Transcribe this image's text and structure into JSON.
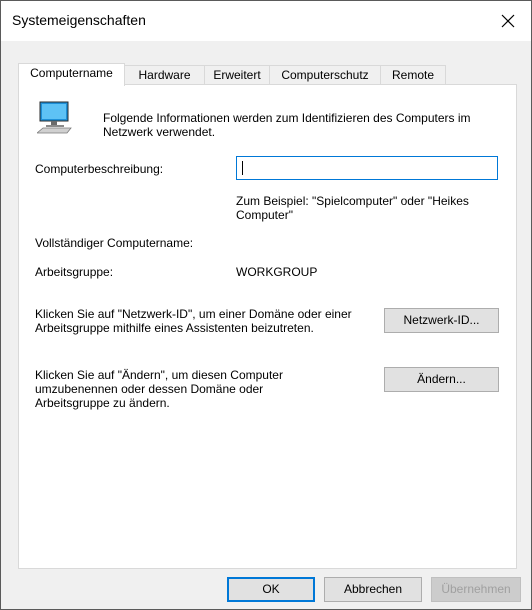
{
  "window": {
    "title": "Systemeigenschaften"
  },
  "tabs": [
    {
      "label": "Computername",
      "active": true
    },
    {
      "label": "Hardware",
      "active": false
    },
    {
      "label": "Erweitert",
      "active": false
    },
    {
      "label": "Computerschutz",
      "active": false
    },
    {
      "label": "Remote",
      "active": false
    }
  ],
  "info": {
    "text": "Folgende Informationen werden zum Identifizieren des Computers im Netzwerk verwendet."
  },
  "description": {
    "label": "Computerbeschreibung:",
    "value": "",
    "hint": "Zum Beispiel: \"Spielcomputer\" oder \"Heikes Computer\""
  },
  "full_name": {
    "label": "Vollständiger Computername:",
    "value": ""
  },
  "workgroup": {
    "label": "Arbeitsgruppe:",
    "value": "WORKGROUP"
  },
  "network_id": {
    "text": "Klicken Sie auf \"Netzwerk-ID\", um einer Domäne oder einer Arbeitsgruppe mithilfe eines Assistenten beizutreten.",
    "button": "Netzwerk-ID..."
  },
  "change": {
    "text": "Klicken Sie auf \"Ändern\", um diesen Computer umzubenennen oder dessen Domäne oder Arbeitsgruppe zu ändern.",
    "button": "Ändern..."
  },
  "footer": {
    "ok": "OK",
    "cancel": "Abbrechen",
    "apply": "Übernehmen"
  },
  "colors": {
    "accent": "#0078d7",
    "window_bg": "#f0f0f0",
    "panel_bg": "#ffffff"
  }
}
